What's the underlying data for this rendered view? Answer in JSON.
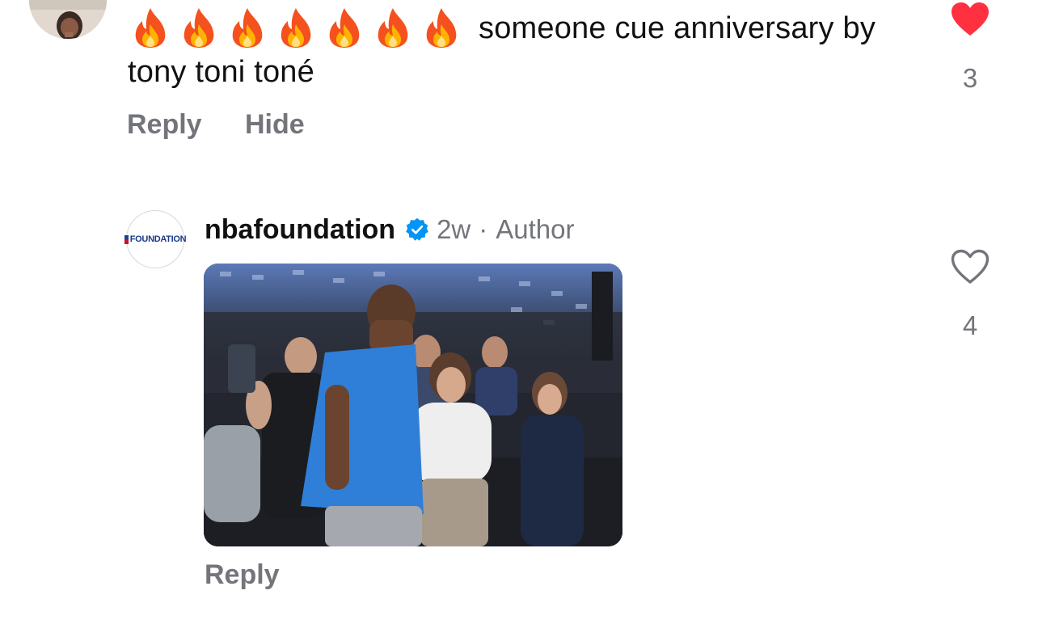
{
  "comment1": {
    "fire_emoji_count": 7,
    "text": "someone cue anniversary by tony toni toné",
    "actions": {
      "reply": "Reply",
      "hide": "Hide"
    },
    "like": {
      "liked": true,
      "count": "3",
      "color": "#ff3040"
    }
  },
  "comment2": {
    "username": "nbafoundation",
    "verified": true,
    "time": "2w",
    "separator": "·",
    "role": "Author",
    "avatar_text": "FOUNDATION",
    "actions": {
      "reply": "Reply"
    },
    "like": {
      "liked": false,
      "count": "4"
    },
    "media": {
      "type": "gif",
      "description_icon": "image-thumbnail"
    }
  },
  "colors": {
    "text_primary": "#111111",
    "text_secondary": "#73757b",
    "verified_blue": "#0095f6",
    "like_red": "#ff3040"
  }
}
